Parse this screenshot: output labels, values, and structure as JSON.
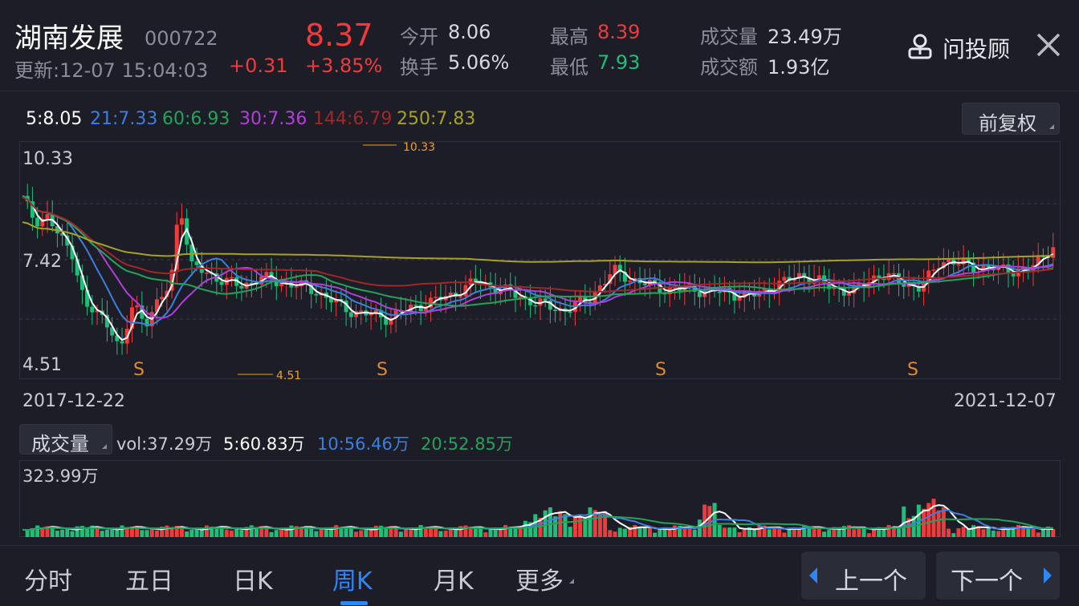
{
  "header": {
    "stock_name": "湖南发展",
    "stock_code": "000722",
    "price": "8.37",
    "change": "+0.31",
    "change_pct": "+3.85%",
    "update_label": "更新:12-07 15:04:03",
    "open_label": "今开",
    "open": "8.06",
    "turnover_label": "换手",
    "turnover": "5.06%",
    "high_label": "最高",
    "high": "8.39",
    "low_label": "最低",
    "low": "7.93",
    "volume_label": "成交量",
    "volume": "23.49万",
    "amount_label": "成交额",
    "amount": "1.93亿",
    "ask_label": "问投顾"
  },
  "ma_legend": {
    "ma5": "5:8.05",
    "ma21": "21:7.33",
    "ma60": "60:6.93",
    "ma30": "30:7.36",
    "ma144": "144:6.79",
    "ma250": "250:7.83"
  },
  "adjust_button": "前复权",
  "price_chart": {
    "y_labels": [
      "10.33",
      "7.42",
      "4.51"
    ],
    "max_marker": "10.33",
    "min_marker": "4.51",
    "s_markers": [
      "S",
      "S",
      "S",
      "S"
    ],
    "start_date": "2017-12-22",
    "end_date": "2021-12-07"
  },
  "volume_section": {
    "selector": "成交量",
    "vol": "vol:37.29万",
    "ma5": "5:60.83万",
    "ma10": "10:56.46万",
    "ma20": "20:52.85万",
    "max_label": "323.99万"
  },
  "tabs": [
    "分时",
    "五日",
    "日K",
    "周K",
    "月K",
    "更多"
  ],
  "active_tab": "周K",
  "nav": {
    "prev": "上一个",
    "next": "下一个"
  },
  "colors": {
    "up": "#ef3b3b",
    "down": "#1fbf7a",
    "ma5": "#ffffff",
    "ma21": "#3d7fe0",
    "ma60": "#22a45a",
    "ma30": "#b040d8",
    "ma144": "#a02828",
    "ma250": "#a6a226",
    "accent": "#2f86f6"
  }
}
